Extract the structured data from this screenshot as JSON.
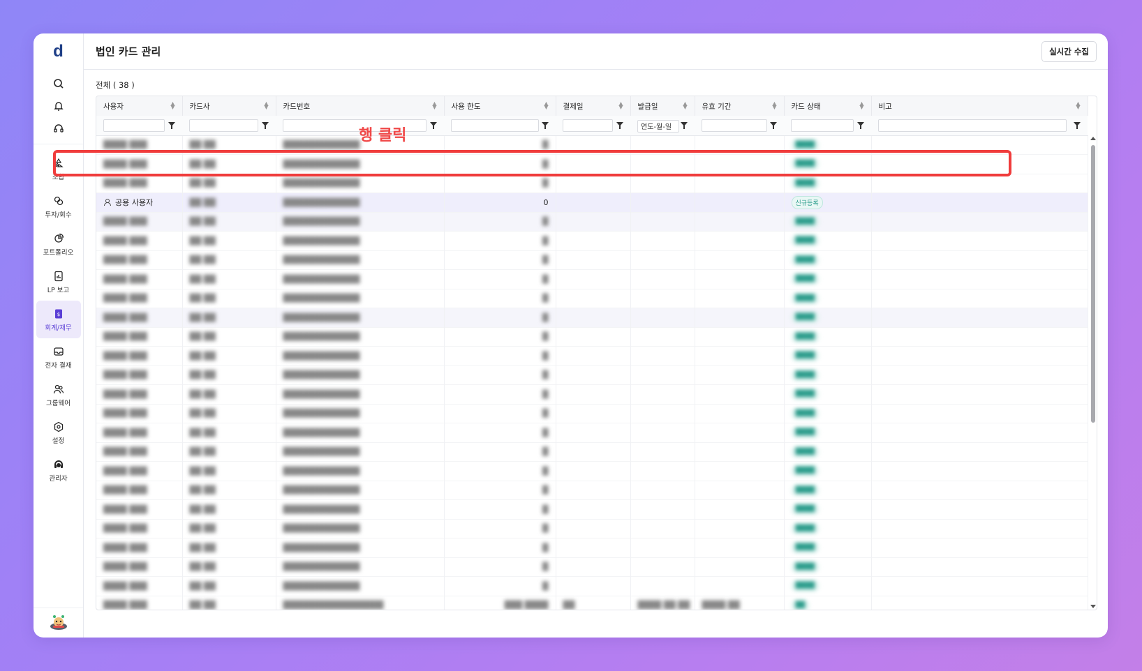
{
  "app": {
    "logo": "d"
  },
  "sidebar": {
    "nav": [
      {
        "label": "조합",
        "icon": "recycle-icon"
      },
      {
        "label": "투자/회수",
        "icon": "coins-icon"
      },
      {
        "label": "포트폴리오",
        "icon": "pie-chart-icon"
      },
      {
        "label": "LP 보고",
        "icon": "report-icon"
      },
      {
        "label": "회계/재무",
        "icon": "ledger-icon",
        "active": true
      },
      {
        "label": "전자 결재",
        "icon": "inbox-icon"
      },
      {
        "label": "그룹웨어",
        "icon": "users-icon"
      },
      {
        "label": "설정",
        "icon": "gear-icon"
      },
      {
        "label": "관리자",
        "icon": "admin-headset-icon"
      }
    ]
  },
  "header": {
    "title": "법인 카드 관리",
    "collect_button": "실시간 수집"
  },
  "total_label": "전체 ( 38 )",
  "table": {
    "columns": [
      "사용자",
      "카드사",
      "카드번호",
      "사용 한도",
      "결제일",
      "발급일",
      "유효 기간",
      "카드 상태",
      "비고"
    ],
    "date_filter_value": "연도-월-일",
    "selected_row": {
      "user": "공용 사용자",
      "limit": "0",
      "status": "신규등록"
    }
  },
  "annotation": {
    "text": "행 클릭"
  },
  "colors": {
    "accent": "#5b3fd6",
    "highlight": "#f03c3c",
    "status_new": "#2b9c8b"
  }
}
